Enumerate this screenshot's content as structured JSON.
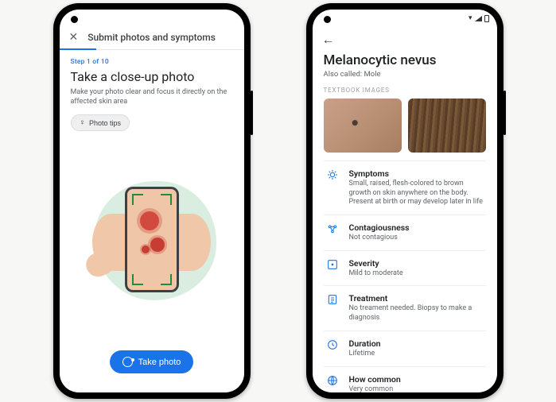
{
  "left": {
    "topbar_title": "Submit photos and symptoms",
    "step_label": "Step 1 of 10",
    "heading": "Take a close-up photo",
    "subtext": "Make your photo clear and focus it directly on the affected skin area",
    "tips_chip": "Photo tips",
    "cta_label": "Take photo"
  },
  "right": {
    "title": "Melanocytic nevus",
    "also_called": "Also called: Mole",
    "section_label": "TEXTBOOK IMAGES",
    "info": [
      {
        "icon": "symptoms",
        "title": "Symptoms",
        "desc": "Small, raised, flesh-colored to brown growth on skin anywhere on the body. Present at birth or may develop later in life"
      },
      {
        "icon": "contagiousness",
        "title": "Contagiousness",
        "desc": "Not contagious"
      },
      {
        "icon": "severity",
        "title": "Severity",
        "desc": "Mild to moderate"
      },
      {
        "icon": "treatment",
        "title": "Treatment",
        "desc": "No treament needed. Biopsy to make a diagnosis"
      },
      {
        "icon": "duration",
        "title": "Duration",
        "desc": "Lifetime"
      },
      {
        "icon": "how-common",
        "title": "How common",
        "desc": "Very common"
      }
    ]
  }
}
